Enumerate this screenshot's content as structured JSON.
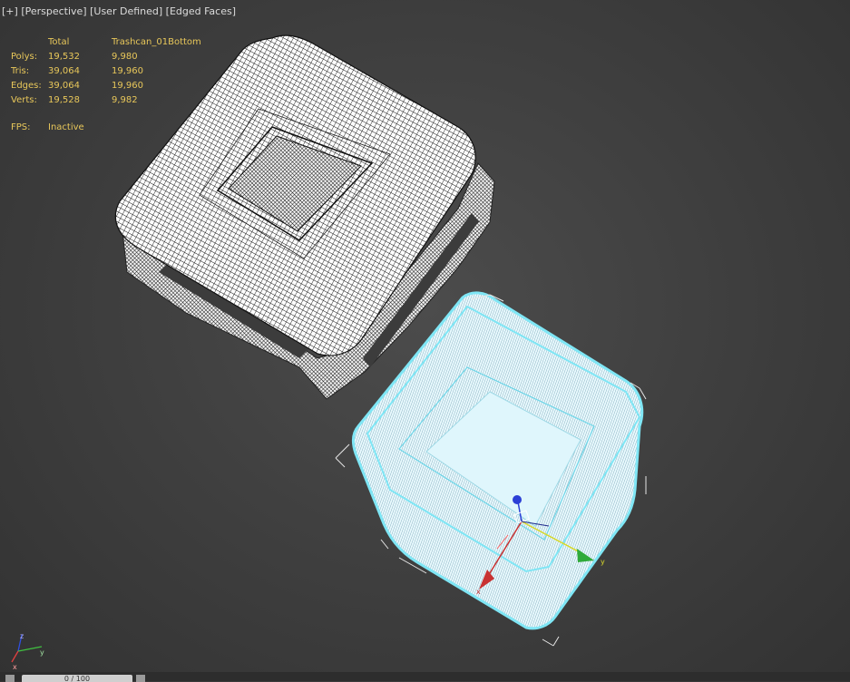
{
  "viewport": {
    "plus": "[+]",
    "view": "[Perspective]",
    "mode": "[User Defined]",
    "shading": "[Edged Faces]"
  },
  "stats": {
    "headers": [
      "",
      "Total",
      "Trashcan_01Bottom"
    ],
    "rows": [
      {
        "label": "Polys:",
        "total": "19,532",
        "object": "9,980"
      },
      {
        "label": "Tris:",
        "total": "39,064",
        "object": "19,960"
      },
      {
        "label": "Edges:",
        "total": "39,064",
        "object": "19,960"
      },
      {
        "label": "Verts:",
        "total": "19,528",
        "object": "9,982"
      }
    ],
    "fps_label": "FPS:",
    "fps_value": "Inactive"
  },
  "gizmo": {
    "x": "x",
    "y": "y",
    "z": "z"
  },
  "axis_tripod": {
    "x": "x",
    "y": "y",
    "z": "z"
  },
  "timeline": {
    "frame": "0 / 100"
  },
  "colors": {
    "selection": "#7fe6f5",
    "stats_text": "#e8c75a",
    "background": "#404040"
  }
}
